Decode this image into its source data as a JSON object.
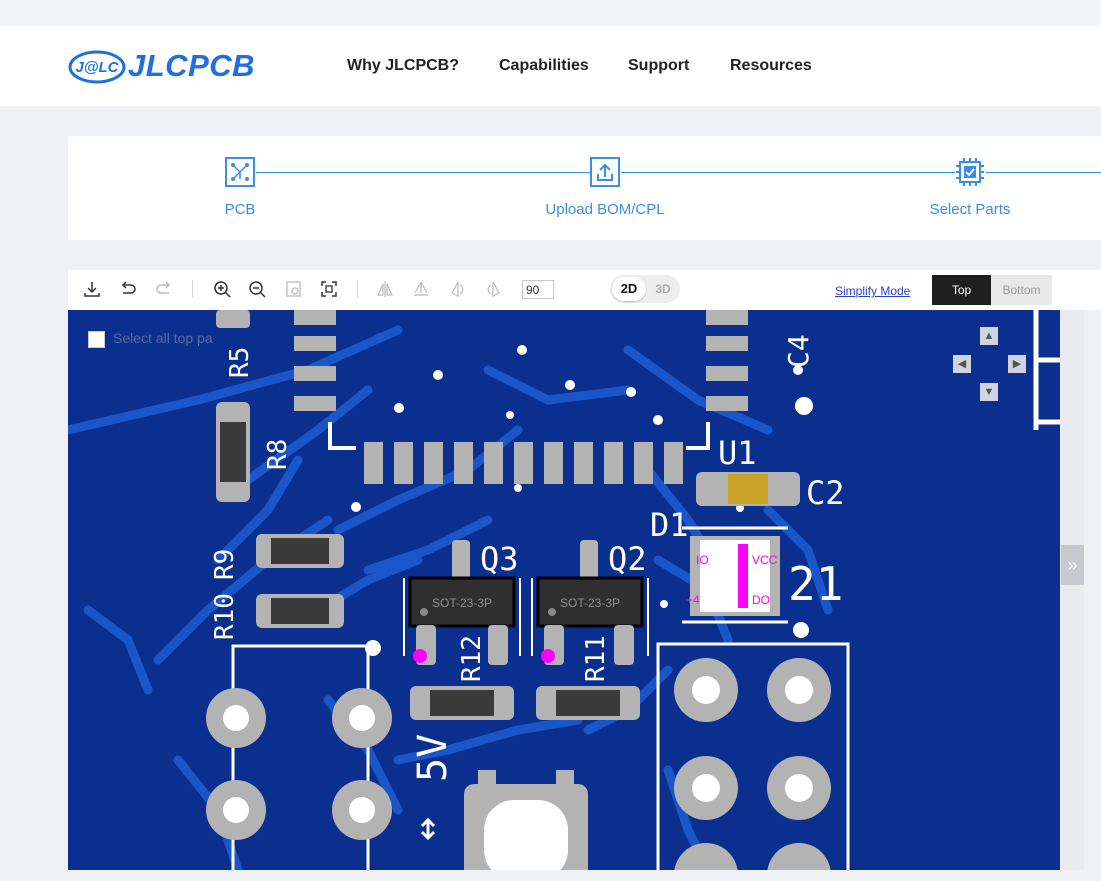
{
  "header": {
    "logo_badge": "J@LC",
    "logo_text": "JLCPCB",
    "nav": [
      "Why JLCPCB?",
      "Capabilities",
      "Support",
      "Resources"
    ]
  },
  "steps": [
    {
      "label": "PCB",
      "icon": "pcb-icon"
    },
    {
      "label": "Upload BOM/CPL",
      "icon": "upload-icon"
    },
    {
      "label": "Select Parts",
      "icon": "chip-check-icon"
    }
  ],
  "toolbar": {
    "icons": [
      "download-icon",
      "undo-icon",
      "redo-icon",
      "zoom-in-icon",
      "zoom-out-icon",
      "zoom-area-icon",
      "fit-screen-icon",
      "flip-horizontal-icon",
      "flip-vertical-icon",
      "rotate-left-icon",
      "rotate-right-icon"
    ],
    "rotation_value": "90",
    "view_2d": "2D",
    "view_3d": "3D",
    "simplify_mode": "Simplify Mode",
    "layer_top": "Top",
    "layer_bottom": "Bottom"
  },
  "canvas": {
    "select_all_label": "Select all top pa",
    "designators": [
      "R5",
      "R8",
      "R9",
      "R10",
      "R12",
      "R11",
      "Q3",
      "Q2",
      "U1",
      "C2",
      "C4",
      "D1",
      "21",
      "5V"
    ],
    "package_labels": [
      "SOT-23-3P",
      "SOT-23-3P"
    ],
    "diode_pins": [
      "IO",
      "VCC",
      "+4",
      "DO"
    ]
  },
  "colors": {
    "accent": "#3a8ee6",
    "board": "#0b2f8f",
    "copper": "#1a56c8",
    "silk": "#ffffff",
    "pad": "#b3b3b3",
    "marker": "#ff00ff"
  }
}
